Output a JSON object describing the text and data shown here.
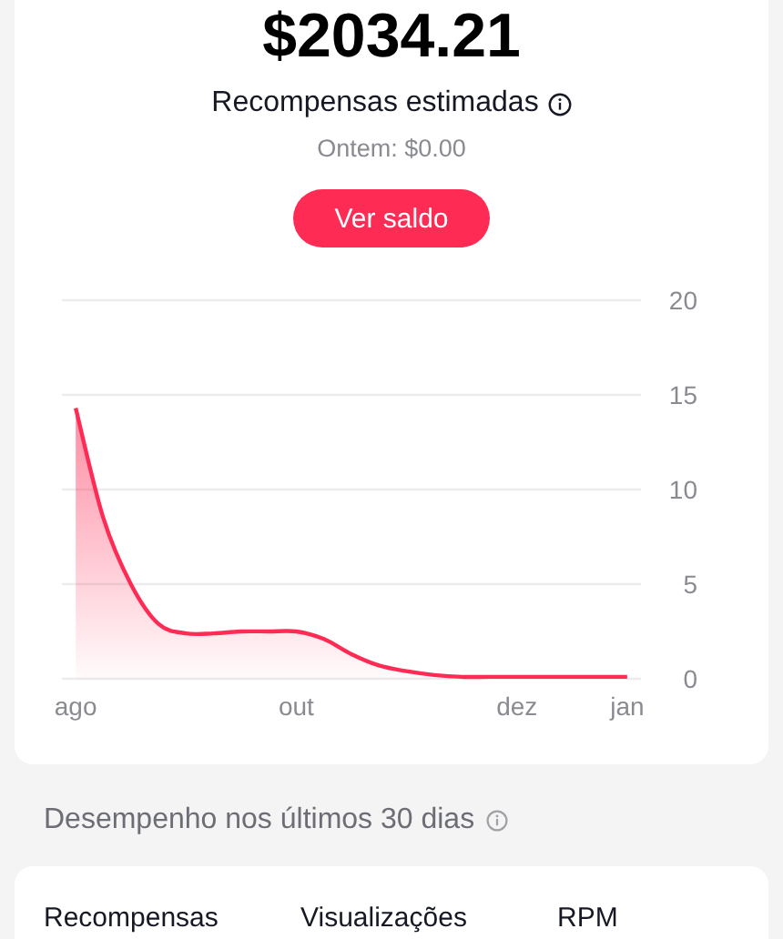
{
  "balance": {
    "amount": "$2034.21",
    "label": "Recompensas estimadas",
    "yesterday": "Ontem: $0.00",
    "button": "Ver saldo"
  },
  "chart_data": {
    "type": "area",
    "categories": [
      "ago",
      null,
      null,
      null,
      null,
      null,
      null,
      null,
      "out",
      null,
      null,
      null,
      null,
      null,
      null,
      null,
      "dez",
      null,
      null,
      null,
      "jan"
    ],
    "series": [
      {
        "color": "#fe2c55",
        "values": [
          14.3,
          8.5,
          5,
          2.9,
          2.4,
          2.4,
          2.5,
          2.5,
          2.5,
          2.1,
          1.3,
          0.7,
          0.4,
          0.2,
          0.1,
          0.1,
          0.1,
          0.1,
          0.1,
          0.1,
          0.1
        ]
      }
    ],
    "grid": true,
    "ylim": [
      0,
      20
    ],
    "yticks": [
      0,
      5,
      10,
      15,
      20
    ]
  },
  "performance": {
    "title": "Desempenho nos últimos 30 dias",
    "columns": [
      "Recompensas",
      "Visualizações",
      "RPM"
    ]
  }
}
